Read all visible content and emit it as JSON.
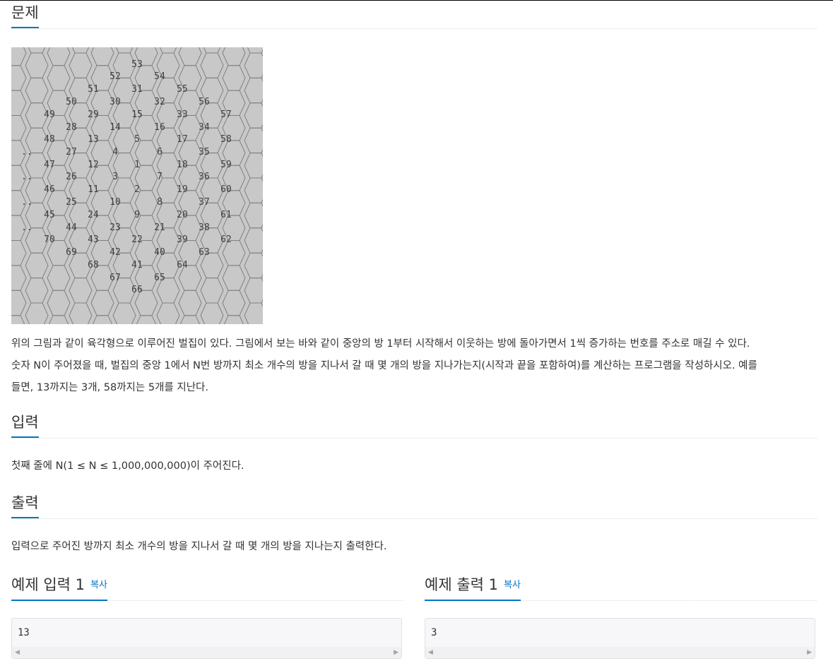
{
  "problem": {
    "title": "문제",
    "image_alt": "hexagonal honeycomb diagram",
    "cells": [
      "53",
      "54",
      "52",
      "51",
      "31",
      "55",
      "50",
      "30",
      "32",
      "56",
      "49",
      "29",
      "15",
      "33",
      "57",
      "28",
      "14",
      "16",
      "34",
      "48",
      "13",
      "5",
      "17",
      "58",
      "27",
      "4",
      "6",
      "35",
      "47",
      "12",
      "1",
      "18",
      "59",
      "26",
      "3",
      "7",
      "36",
      "46",
      "11",
      "2",
      "19",
      "60",
      "25",
      "10",
      "8",
      "37",
      "45",
      "24",
      "9",
      "20",
      "61",
      "44",
      "23",
      "21",
      "38",
      "70",
      "43",
      "22",
      "39",
      "62",
      "69",
      "42",
      "40",
      "63",
      "68",
      "41",
      "64",
      "67",
      "65",
      "66",
      "..",
      "..",
      "..",
      ".."
    ],
    "paragraphs": [
      "위의 그림과 같이 육각형으로 이루어진 벌집이 있다. 그림에서 보는 바와 같이 중앙의 방 1부터 시작해서 이웃하는 방에 돌아가면서 1씩 증가하는 번호를 주소로 매길 수 있다.",
      "숫자 N이 주어졌을 때, 벌집의 중앙 1에서 N번 방까지 최소 개수의 방을 지나서 갈 때 몇 개의 방을 지나가는지(시작과 끝을 포함하여)를 계산하는 프로그램을 작성하시오. 예를",
      "들면, 13까지는 3개, 58까지는 5개를 지난다."
    ]
  },
  "input": {
    "title": "입력",
    "text": "첫째 줄에 N(1 ≤ N ≤ 1,000,000,000)이 주어진다."
  },
  "output": {
    "title": "출력",
    "text": "입력으로 주어진 방까지 최소 개수의 방을 지나서 갈 때 몇 개의 방을 지나는지 출력한다."
  },
  "samples": {
    "input": {
      "title": "예제 입력 1",
      "copy": "복사",
      "value": "13"
    },
    "output": {
      "title": "예제 출력 1",
      "copy": "복사",
      "value": "3"
    }
  },
  "colors": {
    "accent": "#0076c0",
    "image_bg": "#c8c8c8"
  }
}
